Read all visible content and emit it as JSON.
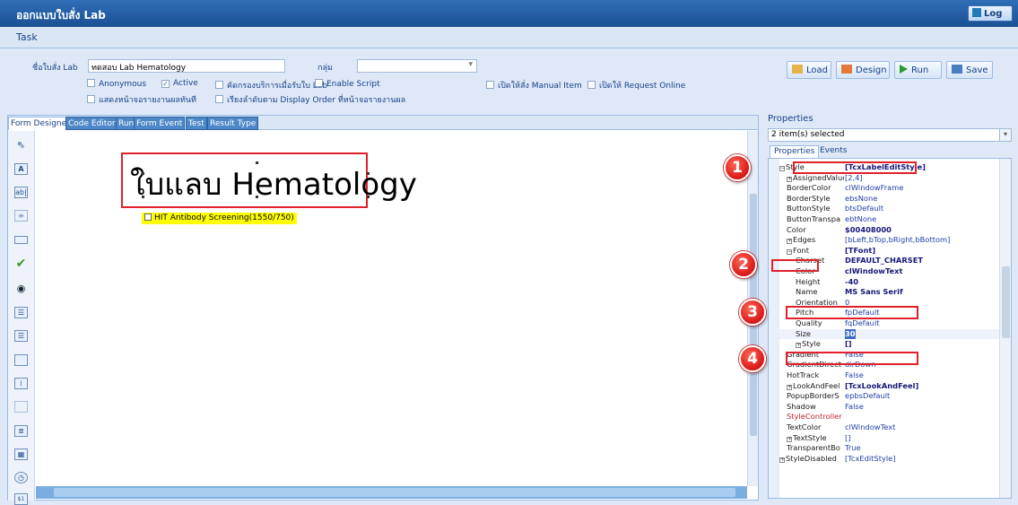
{
  "window": {
    "title": "ออกแบบใบสั่ง Lab",
    "log_button": "Log"
  },
  "menu": {
    "task": "Task"
  },
  "form": {
    "name_label": "ชื่อใบสั่ง Lab",
    "name_value": "ทดสอบ Lab Hematology",
    "group_label": "กลุ่ม",
    "group_value": "",
    "checkboxes": {
      "anonymous": {
        "label": "Anonymous",
        "checked": false
      },
      "active": {
        "label": "Active",
        "checked": true
      },
      "filter_service": {
        "label": "คัดกรองบริการเมื่อรับใบ Lab",
        "checked": false
      },
      "enable_script": {
        "label": "Enable Script",
        "checked": false
      },
      "manual_item": {
        "label": "เปิดให้สั่ง Manual Item",
        "checked": false
      },
      "request_online": {
        "label": "เปิดให้ Request Online",
        "checked": false
      },
      "show_result": {
        "label": "แสดงหน้าจอรายงานผลทันที",
        "checked": false
      },
      "display_order": {
        "label": "เรียงลำดับตาม Display Order ที่หน้าจอรายงานผล",
        "checked": false
      }
    },
    "buttons": {
      "load": "Load",
      "design": "Design",
      "run": "Run",
      "save": "Save"
    }
  },
  "designer": {
    "tabs": [
      "Form Designer",
      "Code Editor",
      "Run",
      "Form Event",
      "Test",
      "Result Type"
    ],
    "active_tab": "Form Designer",
    "canvas_title": "ใบแลบ Hematology",
    "checkbox_item": "HIT Antibody Screening(1550/750)"
  },
  "properties": {
    "header": "Properties",
    "selection": "2 item(s) selected",
    "tabs": [
      "Properties",
      "Events"
    ],
    "rows": [
      {
        "name": "Style",
        "value": "[TcxLabelEditStyle]",
        "expander": "minus",
        "bold": true
      },
      {
        "name": "AssignedValue",
        "value": "[2,4]",
        "expander": "plus",
        "indent": true
      },
      {
        "name": "BorderColor",
        "value": "clWindowFrame",
        "indent": true
      },
      {
        "name": "BorderStyle",
        "value": "ebsNone",
        "indent": true
      },
      {
        "name": "ButtonStyle",
        "value": "btsDefault",
        "indent": true
      },
      {
        "name": "ButtonTranspa",
        "value": "ebtNone",
        "indent": true
      },
      {
        "name": "Color",
        "value": "$00408000",
        "indent": true,
        "bold": true
      },
      {
        "name": "Edges",
        "value": "[bLeft,bTop,bRight,bBottom]",
        "expander": "plus",
        "indent": true
      },
      {
        "name": "Font",
        "value": "[TFont]",
        "expander": "minus",
        "indent": true,
        "bold": true
      },
      {
        "name": "Charset",
        "value": "DEFAULT_CHARSET",
        "indent2": true,
        "bold": true
      },
      {
        "name": "Color",
        "value": "clWindowText",
        "indent2": true,
        "bold": true
      },
      {
        "name": "Height",
        "value": "-40",
        "indent2": true,
        "bold": true
      },
      {
        "name": "Name",
        "value": "MS Sans Serif",
        "indent2": true,
        "bold": true
      },
      {
        "name": "Orientation",
        "value": "0",
        "indent2": true
      },
      {
        "name": "Pitch",
        "value": "fpDefault",
        "indent2": true
      },
      {
        "name": "Quality",
        "value": "fqDefault",
        "indent2": true
      },
      {
        "name": "Size",
        "value": "30",
        "indent2": true,
        "bold": true,
        "selected": true
      },
      {
        "name": "Style",
        "value": "[]",
        "expander": "plus",
        "indent2": true,
        "bold": true
      },
      {
        "name": "Gradient",
        "value": "False",
        "indent": true
      },
      {
        "name": "GradientDirect",
        "value": "dirDown",
        "indent": true
      },
      {
        "name": "HotTrack",
        "value": "False",
        "indent": true
      },
      {
        "name": "LookAndFeel",
        "value": "[TcxLookAndFeel]",
        "expander": "plus",
        "indent": true,
        "bold": true
      },
      {
        "name": "PopupBorderS",
        "value": "epbsDefault",
        "indent": true
      },
      {
        "name": "Shadow",
        "value": "False",
        "indent": true
      },
      {
        "name": "StyleController",
        "value": "",
        "indent": true,
        "red": true
      },
      {
        "name": "TextColor",
        "value": "clWindowText",
        "indent": true
      },
      {
        "name": "TextStyle",
        "value": "[]",
        "expander": "plus",
        "indent": true
      },
      {
        "name": "TransparentBo",
        "value": "True",
        "indent": true
      },
      {
        "name": "StyleDisabled",
        "value": "[TcxEditStyle]",
        "expander": "plus"
      }
    ]
  },
  "annotations": [
    "1",
    "2",
    "3",
    "4"
  ]
}
